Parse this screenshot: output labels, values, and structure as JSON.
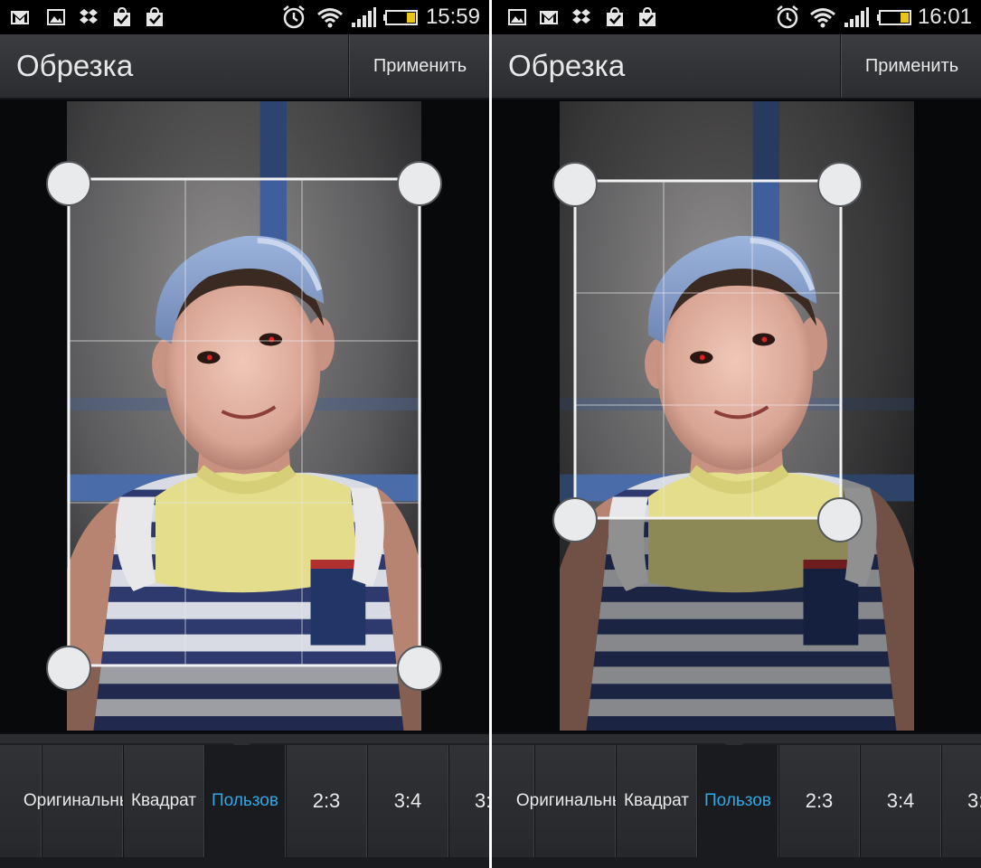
{
  "screens": [
    {
      "status": {
        "time": "15:59",
        "left_icons": [
          "gmail-icon",
          "gallery-icon",
          "dropbox-icon",
          "shopping-bag-check-icon",
          "shopping-bag-check-icon"
        ],
        "right_icons": [
          "alarm-icon",
          "wifi-icon",
          "signal-icon",
          "battery-icon"
        ]
      },
      "action_bar": {
        "title": "Обрезка",
        "apply_label": "Применить"
      },
      "crop_frame": "full",
      "ratio_options": [
        {
          "label": "",
          "selected": false
        },
        {
          "label": "Оригинальный",
          "selected": false
        },
        {
          "label": "Квадрат",
          "selected": false
        },
        {
          "label": "Пользов",
          "selected": true
        },
        {
          "label": "2:3",
          "selected": false
        },
        {
          "label": "3:4",
          "selected": false
        },
        {
          "label": "3:",
          "selected": false
        }
      ]
    },
    {
      "status": {
        "time": "16:01",
        "left_icons": [
          "gallery-icon",
          "gmail-icon",
          "dropbox-icon",
          "shopping-bag-check-icon",
          "shopping-bag-check-icon"
        ],
        "right_icons": [
          "alarm-icon",
          "wifi-icon",
          "signal-icon",
          "battery-icon"
        ]
      },
      "action_bar": {
        "title": "Обрезка",
        "apply_label": "Применить"
      },
      "crop_frame": "upper",
      "ratio_options": [
        {
          "label": "",
          "selected": false
        },
        {
          "label": "Оригинальный",
          "selected": false
        },
        {
          "label": "Квадрат",
          "selected": false
        },
        {
          "label": "Пользов",
          "selected": true
        },
        {
          "label": "2:3",
          "selected": false
        },
        {
          "label": "3:4",
          "selected": false
        },
        {
          "label": "3:",
          "selected": false
        }
      ]
    }
  ],
  "colors": {
    "selected_text": "#31a8e6",
    "battery_fill": "#e8c516"
  }
}
